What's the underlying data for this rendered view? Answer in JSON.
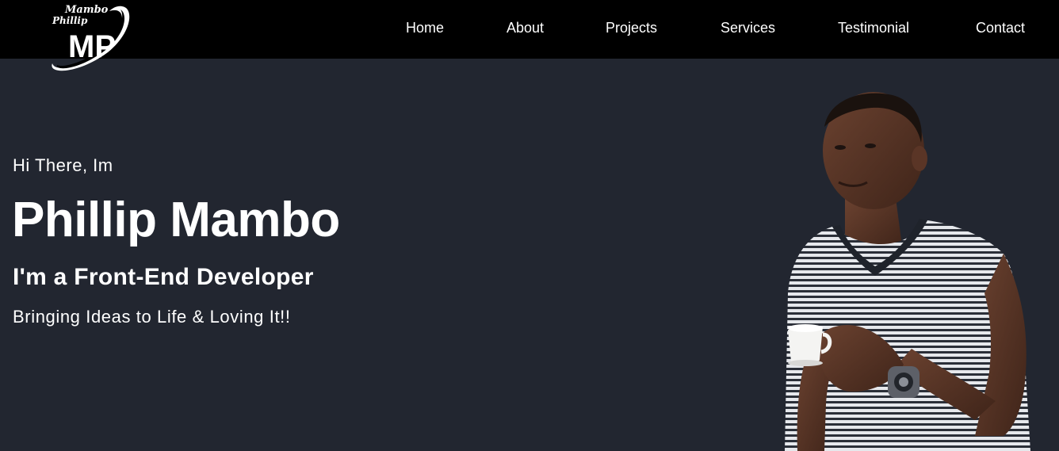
{
  "colors": {
    "header_bg": "#000000",
    "page_bg": "#222630",
    "text": "#ffffff"
  },
  "logo": {
    "top_text": "Mambo",
    "mid_text": "Phillip",
    "initials": "MP"
  },
  "nav": {
    "items": [
      {
        "label": "Home"
      },
      {
        "label": "About"
      },
      {
        "label": "Projects"
      },
      {
        "label": "Services"
      },
      {
        "label": "Testimonial"
      },
      {
        "label": "Contact"
      }
    ]
  },
  "hero": {
    "greeting": "Hi There, Im",
    "name": "Phillip Mambo",
    "role": "I'm a Front-End Developer",
    "tagline": "Bringing Ideas to Life & Loving It!!"
  }
}
